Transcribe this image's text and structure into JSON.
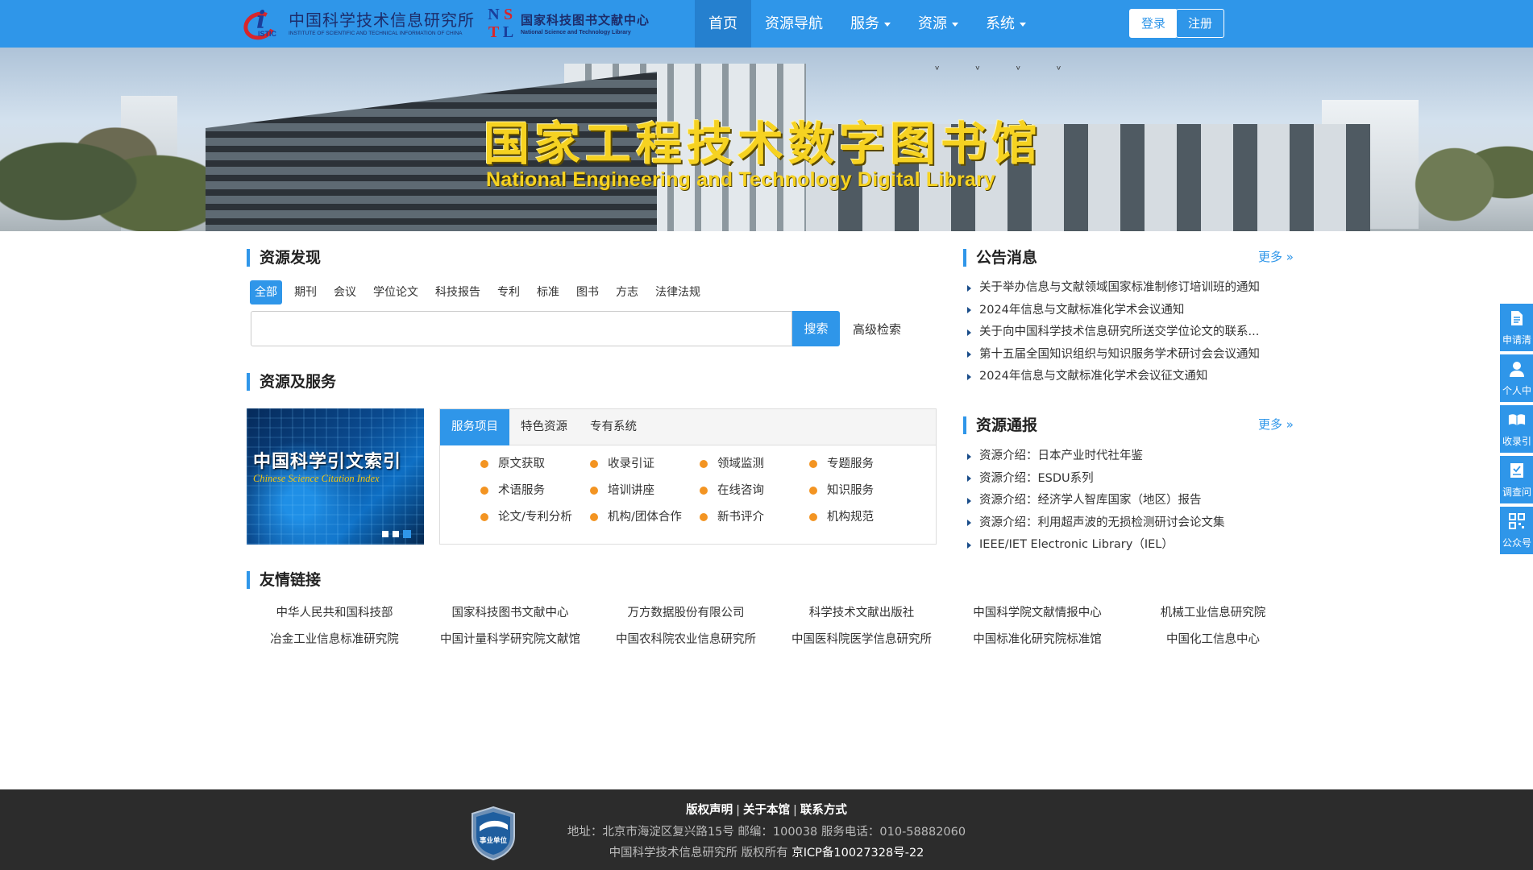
{
  "header": {
    "logo1": {
      "cn": "中国科学技术信息研究所",
      "en": "INSTITUTE OF SCIENTIFIC AND TECHNICAL INFORMATION OF CHINA",
      "mark_letter": "i",
      "mark_sub": "ISTIC"
    },
    "logo2": {
      "cn": "国家科技图书文献中心",
      "en": "National Science and Technology Library",
      "letters": [
        "N",
        "S",
        "T",
        "L"
      ]
    },
    "nav": [
      {
        "label": "首页",
        "active": true,
        "dropdown": false
      },
      {
        "label": "资源导航",
        "active": false,
        "dropdown": false
      },
      {
        "label": "服务",
        "active": false,
        "dropdown": true
      },
      {
        "label": "资源",
        "active": false,
        "dropdown": true
      },
      {
        "label": "系统",
        "active": false,
        "dropdown": true
      }
    ],
    "login_label": "登录",
    "register_label": "注册"
  },
  "banner": {
    "title": "国家工程技术数字图书馆",
    "subtitle": "National Engineering and Technology Digital Library"
  },
  "discovery": {
    "heading": "资源发现",
    "tabs": [
      "全部",
      "期刊",
      "会议",
      "学位论文",
      "科技报告",
      "专利",
      "标准",
      "图书",
      "方志",
      "法律法规"
    ],
    "active_tab": "全部",
    "search_value": "",
    "search_button": "搜索",
    "advanced_link": "高级检索"
  },
  "services": {
    "heading": "资源及服务",
    "carousel": {
      "cn": "中国科学引文索引",
      "en": "Chinese Science Citation Index",
      "slides": 3,
      "active_slide": 3
    },
    "tabs": [
      "服务项目",
      "特色资源",
      "专有系统"
    ],
    "active_tab": "服务项目",
    "items": [
      "原文获取",
      "收录引证",
      "领域监测",
      "专题服务",
      "术语服务",
      "培训讲座",
      "在线咨询",
      "知识服务",
      "论文/专利分析",
      "机构/团体合作",
      "新书评介",
      "机构规范"
    ]
  },
  "announcements": {
    "heading": "公告消息",
    "more": "更多 »",
    "items": [
      "关于举办信息与文献领域国家标准制修订培训班的通知",
      "2024年信息与文献标准化学术会议通知",
      "关于向中国科学技术信息研究所送交学位论文的联系...",
      "第十五届全国知识组织与知识服务学术研讨会会议通知",
      "2024年信息与文献标准化学术会议征文通知"
    ]
  },
  "bulletin": {
    "heading": "资源通报",
    "more": "更多 »",
    "items": [
      "资源介绍：日本产业时代社年鉴",
      "资源介绍：ESDU系列",
      "资源介绍：经济学人智库国家（地区）报告",
      "资源介绍：利用超声波的无损检测研讨会论文集",
      "IEEE/IET Electronic Library（IEL）"
    ]
  },
  "links": {
    "heading": "友情链接",
    "items": [
      "中华人民共和国科技部",
      "国家科技图书文献中心",
      "万方数据股份有限公司",
      "科学技术文献出版社",
      "中国科学院文献情报中心",
      "机械工业信息研究院",
      "冶金工业信息标准研究院",
      "中国计量科学研究院文献馆",
      "中国农科院农业信息研究所",
      "中国医科院医学信息研究所",
      "中国标准化研究院标准馆",
      "中国化工信息中心"
    ]
  },
  "sidebar": [
    {
      "label": "申请清",
      "icon": "document-icon"
    },
    {
      "label": "个人中",
      "icon": "user-icon"
    },
    {
      "label": "收录引",
      "icon": "book-icon"
    },
    {
      "label": "调查问",
      "icon": "survey-icon"
    },
    {
      "label": "公众号",
      "icon": "qrcode-icon"
    }
  ],
  "footer": {
    "links": [
      "版权声明",
      "关于本馆",
      "联系方式"
    ],
    "address": "地址：北京市海淀区复兴路15号 邮编：100038 服务电话：010-58882060",
    "copyright": "中国科学技术信息研究所 版权所有",
    "icp": "京ICP备10027328号-22",
    "badge_text": "事业单位"
  },
  "colors": {
    "primary": "#2f96e9",
    "nav_active": "#2580cf",
    "bullet_orange": "#f39422",
    "footer_bg": "#2c2c2c",
    "banner_title": "#f6d221"
  }
}
